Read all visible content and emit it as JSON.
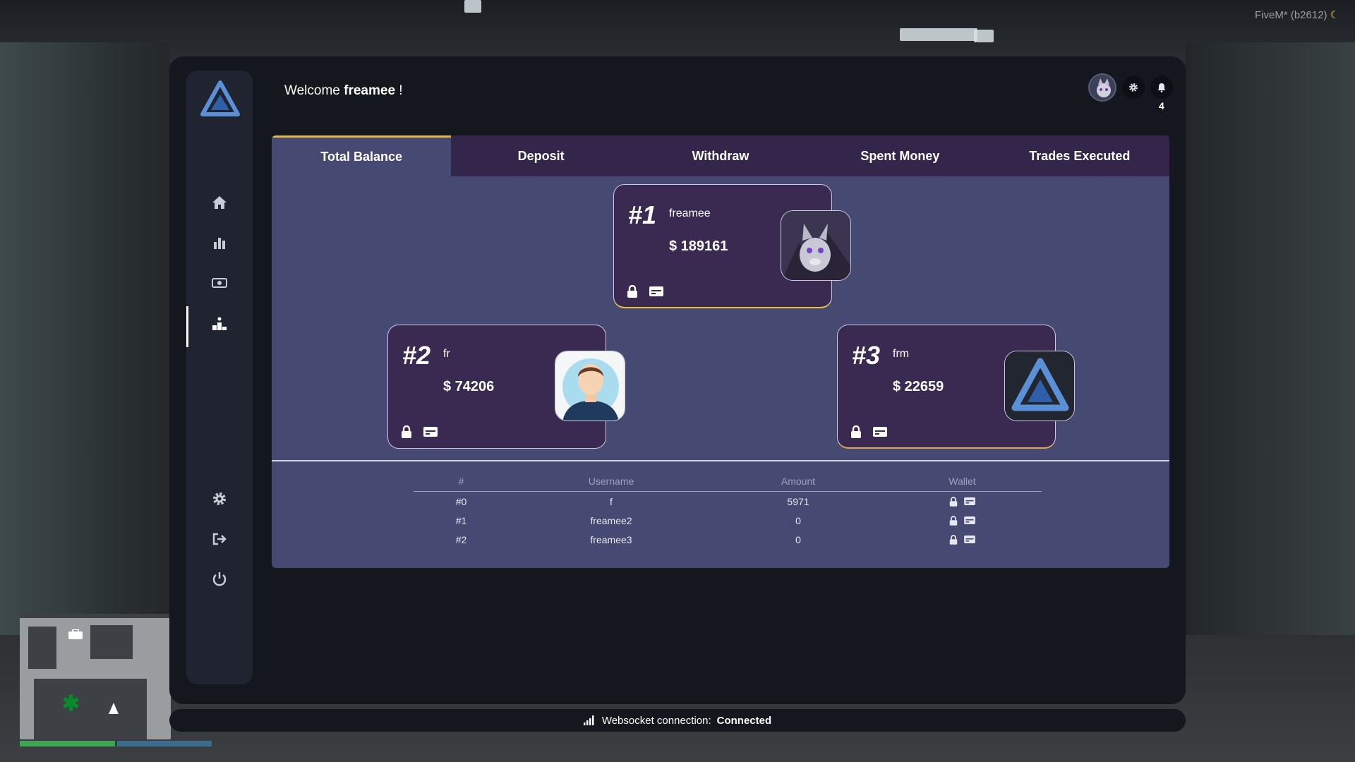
{
  "game": {
    "version_tag": "FiveM* (b2612)",
    "moon_icon": "crescent-moon-icon"
  },
  "sidebar": {
    "logo": "triangle-logo",
    "items": [
      {
        "name": "home",
        "icon": "home-icon"
      },
      {
        "name": "stats",
        "icon": "bar-chart-icon"
      },
      {
        "name": "money",
        "icon": "money-icon"
      },
      {
        "name": "leaderboard",
        "icon": "podium-icon",
        "active": true
      },
      {
        "name": "settings",
        "icon": "gear-icon"
      },
      {
        "name": "logout",
        "icon": "logout-icon"
      },
      {
        "name": "power",
        "icon": "power-icon"
      }
    ]
  },
  "header": {
    "welcome_prefix": "Welcome",
    "username": "freamee",
    "welcome_suffix": "!",
    "notification_count": "4"
  },
  "tabs": [
    "Total Balance",
    "Deposit",
    "Withdraw",
    "Spent Money",
    "Trades Executed"
  ],
  "active_tab": "Total Balance",
  "podium": [
    {
      "rank": "#1",
      "name": "freamee",
      "amount": "$ 189161",
      "avatar": "wolf-avatar"
    },
    {
      "rank": "#2",
      "name": "fr",
      "amount": "$ 74206",
      "avatar": "person-avatar"
    },
    {
      "rank": "#3",
      "name": "frm",
      "amount": "$ 22659",
      "avatar": "triangle-logo-avatar"
    }
  ],
  "table": {
    "headers": [
      "#",
      "Username",
      "Amount",
      "Wallet"
    ],
    "rows": [
      {
        "rank": "#0",
        "username": "f",
        "amount": "5971"
      },
      {
        "rank": "#1",
        "username": "freamee2",
        "amount": "0"
      },
      {
        "rank": "#2",
        "username": "freamee3",
        "amount": "0"
      }
    ]
  },
  "status": {
    "label": "Websocket connection:",
    "value": "Connected"
  },
  "colors": {
    "panel": "#464a72",
    "tabs": "#34264a",
    "card": "#3a2a52",
    "gold": "#e8c23a",
    "app_bg": "#14171d"
  }
}
